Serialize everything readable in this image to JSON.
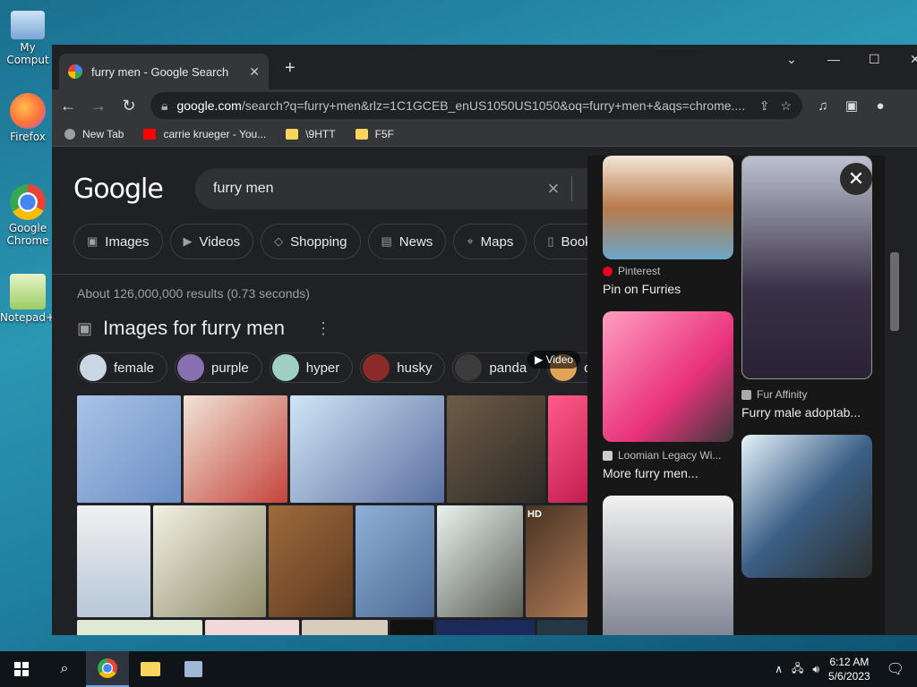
{
  "desktop": {
    "icons": [
      {
        "label": "My Comput",
        "icon": "computer-icon"
      },
      {
        "label": "Firefox",
        "icon": "firefox-icon"
      },
      {
        "label": "Google Chrome",
        "icon": "chrome-icon"
      },
      {
        "label": "Notepad++",
        "icon": "notepad-icon"
      }
    ]
  },
  "browser": {
    "tab": {
      "title": "furry men - Google Search",
      "close": "✕"
    },
    "new_tab": "+",
    "controls": {
      "dropdown": "⌄",
      "minimize": "—",
      "maximize": "☐",
      "close": "✕"
    },
    "url": {
      "host": "google.com",
      "path": "/search?q=furry+men&rlz=1C1GCEB_enUS1050US1050&oq=furry+men+&aqs=chrome...."
    },
    "bookmarks": [
      {
        "label": "New Tab",
        "color": "#9aa0a6"
      },
      {
        "label": "carrie krueger - You...",
        "color": "#ff0000"
      },
      {
        "label": "\\9HTT",
        "color": "#f9d55b"
      },
      {
        "label": "F5F",
        "color": "#f9d55b"
      }
    ]
  },
  "google": {
    "logo": "Google",
    "query": "furry men",
    "tabs": [
      {
        "label": "Images",
        "icon": "image-icon"
      },
      {
        "label": "Videos",
        "icon": "video-icon"
      },
      {
        "label": "Shopping",
        "icon": "tag-icon"
      },
      {
        "label": "News",
        "icon": "news-icon"
      },
      {
        "label": "Maps",
        "icon": "map-pin-icon"
      },
      {
        "label": "Book",
        "icon": "book-icon"
      }
    ],
    "result_stats": "About 126,000,000 results (0.73 seconds)",
    "images_heading": "Images for furry men",
    "image_chips": [
      "female",
      "purple",
      "hyper",
      "husky",
      "panda",
      "canine"
    ],
    "video_label": "▶ Video",
    "hd_label": "HD"
  },
  "panel": {
    "items": [
      {
        "source": "Pinterest",
        "title": "Pin on Furries"
      },
      {
        "source": "Fur Affinity",
        "title": "Furry male adoptab..."
      },
      {
        "source": "Loomian Legacy Wi...",
        "title": "More furry men..."
      }
    ],
    "close": "✕"
  },
  "taskbar": {
    "time": "6:12 AM",
    "date": "5/6/2023"
  }
}
